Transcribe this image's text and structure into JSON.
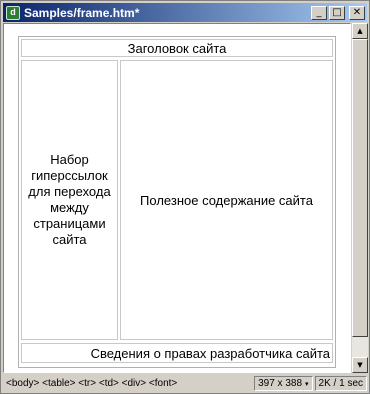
{
  "window": {
    "title": "Samples/frame.htm*",
    "minimize_glyph": "_",
    "maximize_glyph": "□",
    "close_glyph": "✕"
  },
  "document": {
    "header": "Заголовок сайта",
    "navigation": "Набор гиперссылок для перехода между страницами сайта",
    "content": "Полезное содержание сайта",
    "footer": "Сведения о правах разработчика сайта"
  },
  "scrollbar": {
    "up_glyph": "▲",
    "down_glyph": "▼"
  },
  "statusbar": {
    "tag_path": "<body> <table> <tr> <td> <div> <font>",
    "window_size": "397 x 388",
    "size_dropdown_glyph": "▾",
    "download_stats": "2K / 1 sec"
  },
  "colors": {
    "title_gradient_start": "#0a246a",
    "title_gradient_end": "#a6caf0",
    "chrome": "#d4d0c8"
  },
  "icons": {
    "app": "dreamweaver-document-icon"
  }
}
